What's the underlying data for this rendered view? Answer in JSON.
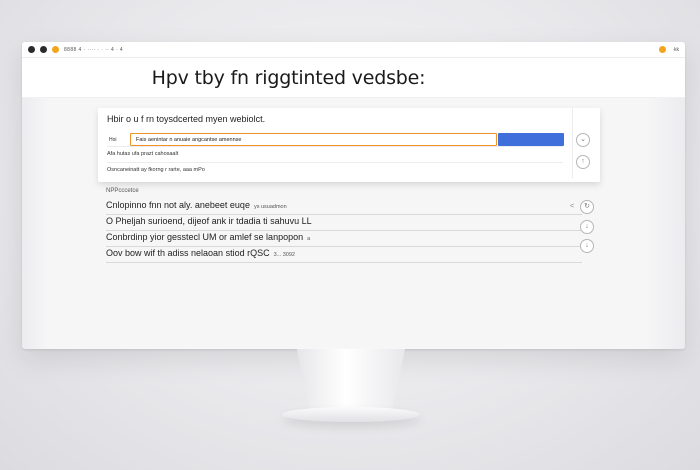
{
  "browser": {
    "url_text": "8888 4 · ···· · · ·· 4 · 4",
    "right_text": "·kk"
  },
  "header": {
    "title": "Hpv tby fn riggtinted vedsbe:"
  },
  "search_card": {
    "heading": "Hbir o u f rn toysdcerted myen webiolct.",
    "query_label": "Hoi",
    "query_value": "Fais aenintar n anuaie angcantse amennse",
    "suggestions": [
      {
        "text": "Afa hutas ufa prazt cahosaalt"
      },
      {
        "text": "Osncaneinatt ay fkorng r rarte, aaa mPo"
      }
    ],
    "button_icons": [
      "chevron-down-icon",
      "arrow-up-icon",
      "refresh-icon"
    ]
  },
  "results": {
    "section_label": "NPPcccetce",
    "items": [
      {
        "text": "Cnlopinno fnn not aly.  anebeet euqe",
        "meta": "ys usuadmon"
      },
      {
        "text": "O Pheljah surioend, dijeof  ank ir tdadia  ti sahuvu  LL",
        "meta": ""
      },
      {
        "text": "Conbrdinp yior gesstecl UM or  amlef se  lanpopon",
        "meta": "a"
      },
      {
        "text": "Oov bow wif th adiss nelaoan stiod rQSC",
        "meta": "3... 3092"
      }
    ],
    "markers": [
      "<",
      "↓",
      "↓"
    ]
  },
  "colors": {
    "accent_orange": "#f0932b",
    "accent_blue": "#3f6fdb"
  }
}
